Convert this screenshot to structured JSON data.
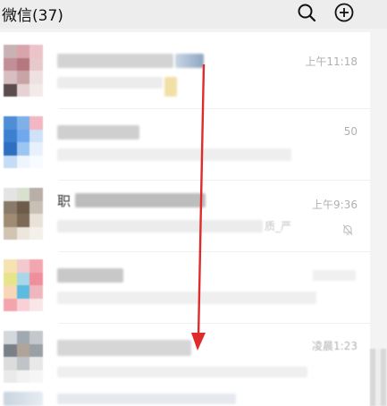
{
  "header": {
    "title": "微信(37)",
    "search_icon": "search-icon",
    "add_icon": "plus-circle-icon"
  },
  "chats": [
    {
      "time": "上午11:18",
      "snippet": ""
    },
    {
      "time": "50",
      "snippet": ""
    },
    {
      "time": "上午9:36",
      "snippet": "质_严",
      "muted": true,
      "title_fragment": "职"
    },
    {
      "time": "",
      "snippet": ""
    },
    {
      "time": "凌晨1:23",
      "snippet": ""
    }
  ],
  "annotation": {
    "arrow_color": "#e02b2b",
    "direction": "down"
  }
}
